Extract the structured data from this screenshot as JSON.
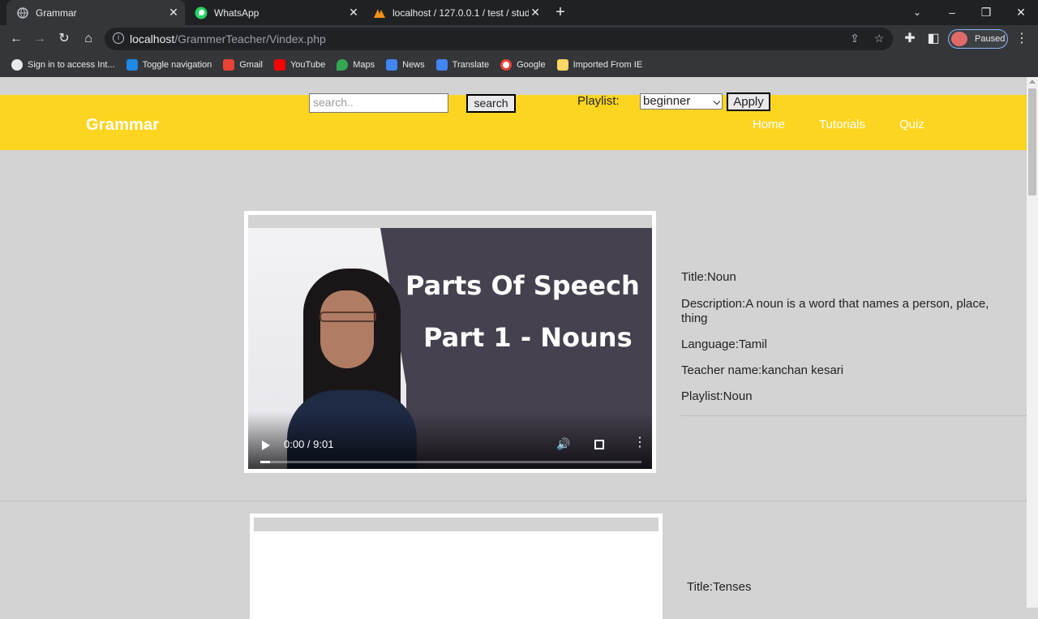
{
  "browser": {
    "tabs": [
      {
        "title": "Grammar",
        "active": true
      },
      {
        "title": "WhatsApp",
        "active": false
      },
      {
        "title": "localhost / 127.0.0.1 / test / stud",
        "active": false
      }
    ],
    "url_host": "localhost",
    "url_path": "/GrammerTeacher/Vindex.php",
    "profile_status": "Paused",
    "bookmarks": [
      {
        "label": "Sign in to access Int...",
        "icon": "globe-icon",
        "color": "#e8eaed"
      },
      {
        "label": "Toggle navigation",
        "icon": "p-icon",
        "color": "#1e88e5"
      },
      {
        "label": "Gmail",
        "icon": "gmail-icon",
        "color": "#ea4335"
      },
      {
        "label": "YouTube",
        "icon": "youtube-icon",
        "color": "#ff0000"
      },
      {
        "label": "Maps",
        "icon": "maps-icon",
        "color": "#34a853"
      },
      {
        "label": "News",
        "icon": "news-icon",
        "color": "#4285f4"
      },
      {
        "label": "Translate",
        "icon": "translate-icon",
        "color": "#4285f4"
      },
      {
        "label": "Google",
        "icon": "google-icon",
        "color": "#fbbc05"
      },
      {
        "label": "Imported From IE",
        "icon": "folder-icon",
        "color": "#fdd663"
      }
    ]
  },
  "site": {
    "brand": "Grammar",
    "nav": [
      "Home",
      "Tutorials",
      "Quiz"
    ],
    "header_color": "#fdd521"
  },
  "search": {
    "placeholder": "search..",
    "button": "search"
  },
  "playlist": {
    "label": "Playlist:",
    "selected": "beginner",
    "apply": "Apply"
  },
  "videos": [
    {
      "thumb_line1": "Parts Of Speech",
      "thumb_line2": "Part 1 - Nouns",
      "time": "0:00 / 9:01",
      "title": "Title:Noun",
      "description": "Description:A noun is a word that names a person, place, thing",
      "language": "Language:Tamil",
      "teacher": "Teacher name:kanchan kesari",
      "playlist": "Playlist:Noun"
    },
    {
      "title": "Title:Tenses"
    }
  ]
}
